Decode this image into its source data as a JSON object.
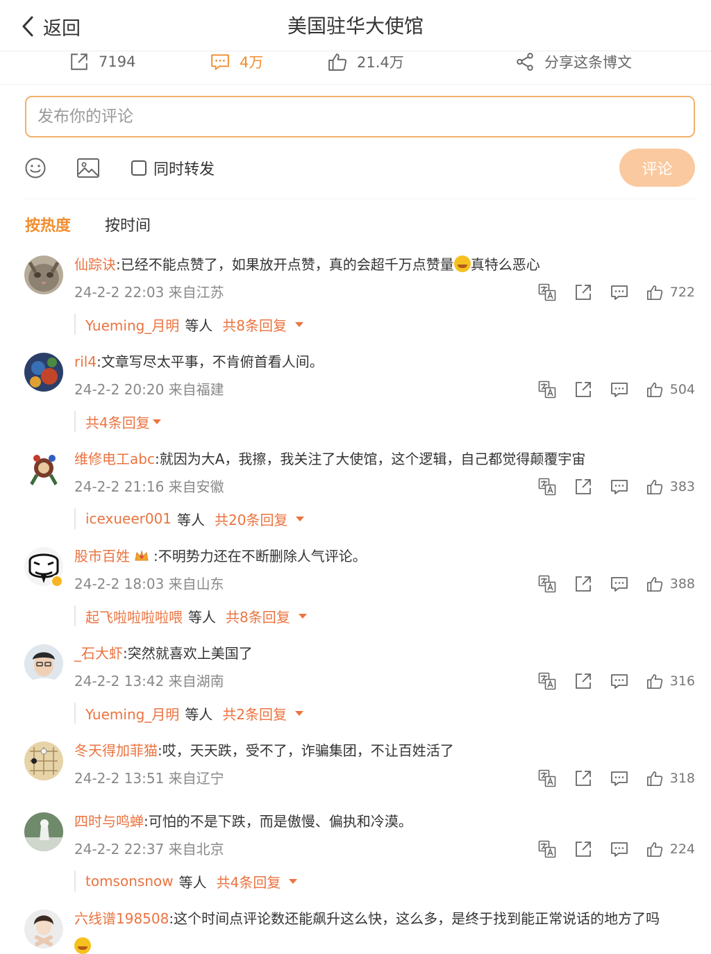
{
  "nav": {
    "back_label": "返回",
    "title": "美国驻华大使馆"
  },
  "stats": {
    "reposts": "7194",
    "comments": "4万",
    "likes": "21.4万",
    "share_label": "分享这条博文"
  },
  "compose": {
    "placeholder": "发布你的评论",
    "repost_label": "同时转发",
    "submit_label": "评论"
  },
  "sort": {
    "hot": "按热度",
    "time": "按时间"
  },
  "colors": {
    "accent": "#f28d2e",
    "username": "#eb7340",
    "submit_bg": "#fbc99f",
    "input_border": "#f2b06b"
  },
  "comments": [
    {
      "user": "仙踪诀",
      "text_before_emoji": ":已经不能点赞了，如果放开点赞，真的会超千万点赞量",
      "text_after_emoji": "真特么恶心",
      "meta": "24-2-2 22:03 来自江苏",
      "likes": "722",
      "reply_user": "Yueming_月明",
      "reply_etc": "等人",
      "reply_total": "共8条回复"
    },
    {
      "user": "ril4",
      "text": ":文章写尽太平事，不肯俯首看人间。",
      "meta": "24-2-2 20:20 来自福建",
      "likes": "504",
      "reply_total": "共4条回复"
    },
    {
      "user": "维修电工abc",
      "text": ":就因为大A，我擦，我关注了大使馆，这个逻辑，自己都觉得颠覆宇宙",
      "meta": "24-2-2 21:16 来自安徽",
      "likes": "383",
      "reply_user": "icexueer001",
      "reply_etc": "等人",
      "reply_total": "共20条回复"
    },
    {
      "user": "股市百姓",
      "text": ":不明势力还在不断删除人气评论。",
      "meta": "24-2-2 18:03 来自山东",
      "likes": "388",
      "reply_user": "起飞啦啦啦啦喂",
      "reply_etc": "等人",
      "reply_total": "共8条回复"
    },
    {
      "user": "_石大虾",
      "text": ":突然就喜欢上美国了",
      "meta": "24-2-2 13:42 来自湖南",
      "likes": "316",
      "reply_user": "Yueming_月明",
      "reply_etc": "等人",
      "reply_total": "共2条回复"
    },
    {
      "user": "冬天得加菲猫",
      "text": ":哎，天天跌，受不了，诈骗集团，不让百姓活了",
      "meta": "24-2-2 13:51 来自辽宁",
      "likes": "318"
    },
    {
      "user": "四时与鸣蝉",
      "text": ":可怕的不是下跌，而是傲慢、偏执和冷漠。",
      "meta": "24-2-2 22:37 来自北京",
      "likes": "224",
      "reply_user": "tomsonsnow",
      "reply_etc": "等人",
      "reply_total": "共4条回复"
    },
    {
      "user": "六线谱198508",
      "text": ":这个时间点评论数还能飙升这么快，这么多，是终于找到能正常说话的地方了吗"
    }
  ]
}
